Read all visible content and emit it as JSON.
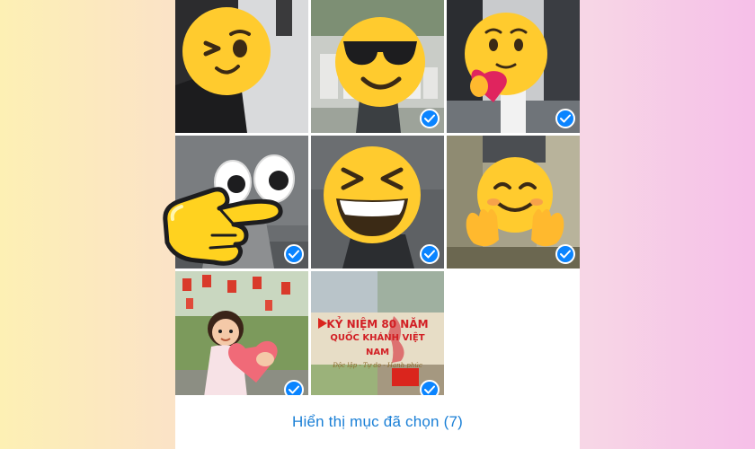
{
  "footer": {
    "show_selected_label": "Hiển thị mục đã chọn (7)"
  },
  "photos": [
    {
      "emoji": "winking-face",
      "selected": false
    },
    {
      "emoji": "smiling-face-with-sunglasses",
      "selected": true
    },
    {
      "emoji": "face-holding-heart",
      "selected": true
    },
    {
      "emoji": "eyes-googly",
      "selected": true
    },
    {
      "emoji": "grinning-squinting-face",
      "selected": true
    },
    {
      "emoji": "smiling-face-open-hands",
      "selected": true
    },
    {
      "emoji": "cartoon-girl-with-heart",
      "selected": true
    },
    {
      "emoji": "anniversary-poster-collage",
      "selected": true
    }
  ],
  "poster": {
    "line1": "KỶ NIỆM 80 NĂM",
    "line2": "QUỐC KHÁNH VIỆT NAM",
    "line3": "Độc lập - Tự do - Hạnh phúc"
  },
  "colors": {
    "accent": "#0a84ff",
    "link": "#1a7fd6",
    "emoji_yellow": "#ffcb2e"
  }
}
